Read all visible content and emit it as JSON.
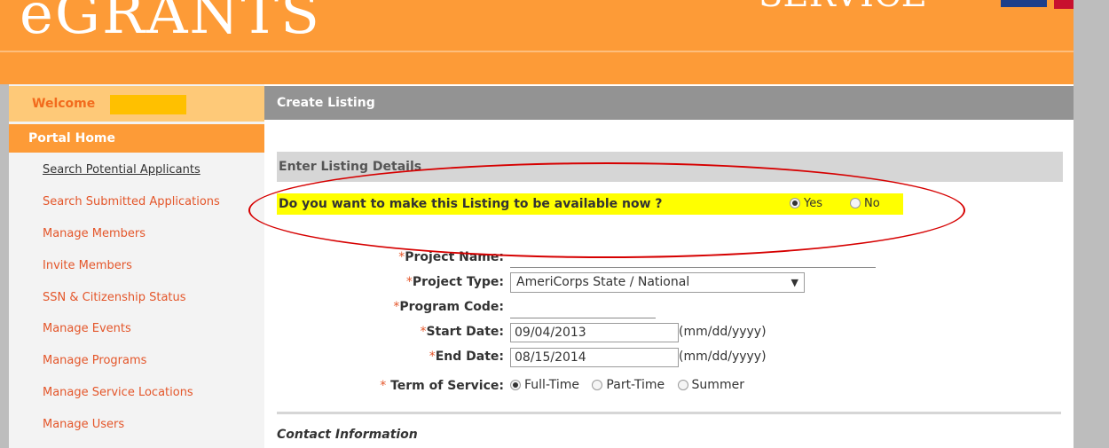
{
  "header": {
    "logo": "eGRANTS",
    "brand_partial": "SERVICE",
    "colors": {
      "orange": "#fd9b37",
      "light_orange": "#fec978",
      "gray": "#939393"
    }
  },
  "sidebar": {
    "welcome_label": "Welcome",
    "portal_home": "Portal Home",
    "items": [
      {
        "label": "Search Potential Applicants"
      },
      {
        "label": "Search Submitted Applications"
      },
      {
        "label": "Manage Members"
      },
      {
        "label": "Invite Members"
      },
      {
        "label": "SSN & Citizenship Status"
      },
      {
        "label": "Manage Events"
      },
      {
        "label": "Manage Programs"
      },
      {
        "label": "Manage Service Locations"
      },
      {
        "label": "Manage Users"
      }
    ]
  },
  "main": {
    "section_title": "Create Listing",
    "details_header": "Enter Listing Details",
    "availability": {
      "question": "Do you want to make this Listing to be available now ?",
      "yes": "Yes",
      "no": "No",
      "selected": "Yes"
    },
    "form": {
      "required_marker": "*",
      "project_name_label": "Project Name:",
      "project_name_value": "",
      "project_type_label": "Project Type:",
      "project_type_value": "AmeriCorps State / National",
      "program_code_label": "Program Code:",
      "program_code_value": "",
      "start_date_label": "Start Date:",
      "start_date_value": "09/04/2013",
      "end_date_label": "End Date:",
      "end_date_value": "08/15/2014",
      "date_hint": "(mm/dd/yyyy)",
      "term_label": "Term of Service:",
      "term_options": [
        "Full-Time",
        "Part-Time",
        "Summer"
      ],
      "term_selected": "Full-Time"
    },
    "contact_header": "Contact Information"
  }
}
